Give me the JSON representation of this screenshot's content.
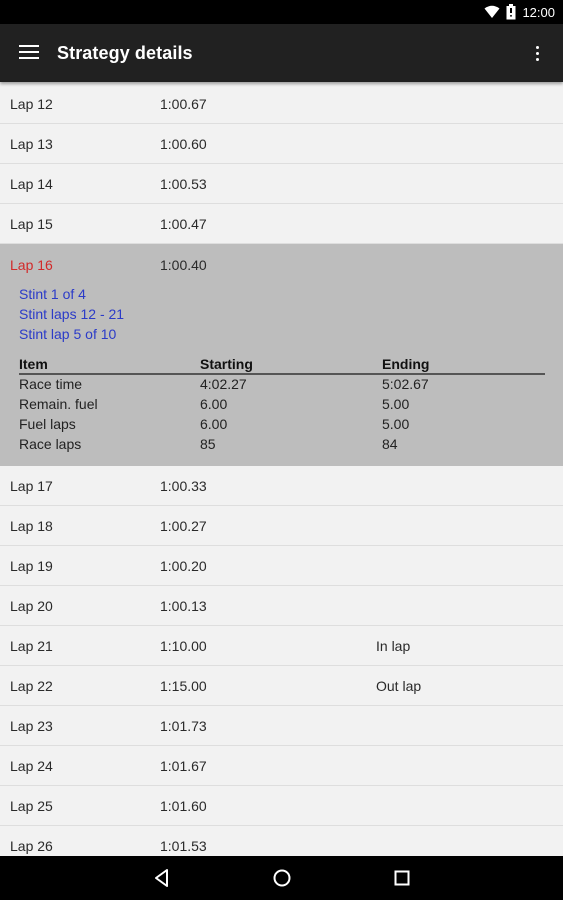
{
  "status_bar": {
    "time": "12:00"
  },
  "app_bar": {
    "title": "Strategy details"
  },
  "laps_before": [
    {
      "lap": "Lap 12",
      "time": "1:00.67",
      "note": ""
    },
    {
      "lap": "Lap 13",
      "time": "1:00.60",
      "note": ""
    },
    {
      "lap": "Lap 14",
      "time": "1:00.53",
      "note": ""
    },
    {
      "lap": "Lap 15",
      "time": "1:00.47",
      "note": ""
    }
  ],
  "expanded_lap": {
    "lap": "Lap 16",
    "time": "1:00.40",
    "stint": "Stint 1 of 4",
    "stint_laps": "Stint laps 12 - 21",
    "stint_lap": "Stint lap 5 of 10",
    "table_headers": [
      "Item",
      "Starting",
      "Ending"
    ],
    "table_rows": [
      [
        "Race time",
        "4:02.27",
        "5:02.67"
      ],
      [
        "Remain. fuel",
        "6.00",
        "5.00"
      ],
      [
        "Fuel laps",
        "6.00",
        "5.00"
      ],
      [
        "Race laps",
        "85",
        "84"
      ]
    ]
  },
  "laps_after": [
    {
      "lap": "Lap 17",
      "time": "1:00.33",
      "note": ""
    },
    {
      "lap": "Lap 18",
      "time": "1:00.27",
      "note": ""
    },
    {
      "lap": "Lap 19",
      "time": "1:00.20",
      "note": ""
    },
    {
      "lap": "Lap 20",
      "time": "1:00.13",
      "note": ""
    },
    {
      "lap": "Lap 21",
      "time": "1:10.00",
      "note": "In lap"
    },
    {
      "lap": "Lap 22",
      "time": "1:15.00",
      "note": "Out lap"
    },
    {
      "lap": "Lap 23",
      "time": "1:01.73",
      "note": ""
    },
    {
      "lap": "Lap 24",
      "time": "1:01.67",
      "note": ""
    },
    {
      "lap": "Lap 25",
      "time": "1:01.60",
      "note": ""
    },
    {
      "lap": "Lap 26",
      "time": "1:01.53",
      "note": ""
    }
  ],
  "icons": {
    "status": [
      "wifi-icon",
      "battery-icon"
    ],
    "app_bar": [
      "menu-icon",
      "overflow-menu-icon"
    ],
    "nav": [
      "back-icon",
      "home-icon",
      "recents-icon"
    ]
  },
  "colors": {
    "app_bar": "#212121",
    "expanded_background": "#bdbdbd",
    "expanded_lap_label": "#d22a2a",
    "stint_text": "#2b3bc8"
  }
}
